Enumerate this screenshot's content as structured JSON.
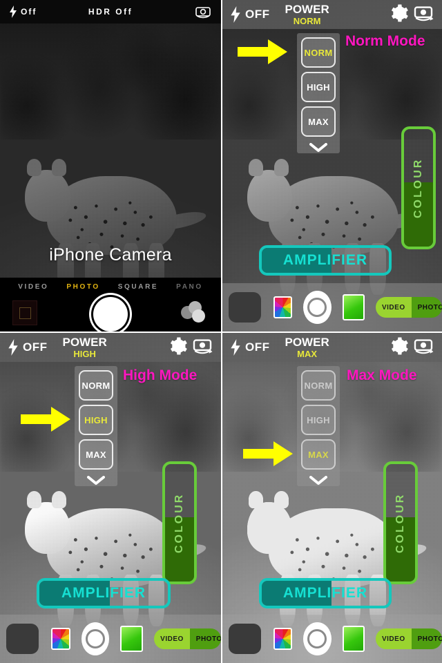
{
  "panels": {
    "ios": {
      "name": "iPhone Camera native app",
      "flash_label": "Off",
      "hdr_label": "HDR Off",
      "caption": "iPhone Camera",
      "flip_icon": "camera-flip-icon",
      "bolt_icon": "flash-bolt-icon",
      "modes": [
        {
          "label": "VIDEO",
          "state": "inactive"
        },
        {
          "label": "PHOTO",
          "state": "active"
        },
        {
          "label": "SQUARE",
          "state": "inactive"
        },
        {
          "label": "PANO",
          "state": "dim"
        }
      ]
    },
    "norm": {
      "name": "Norm Mode screenshot",
      "header": {
        "flash_label": "OFF",
        "power_label": "POWER",
        "power_value": "NORM",
        "bolt_icon": "flash-bolt-icon",
        "gear_icon": "gear-icon",
        "flip_icon": "camera-flip-icon"
      },
      "caption": "Norm Mode",
      "selected_mode": "NORM",
      "mode_buttons": [
        "NORM",
        "HIGH",
        "MAX"
      ],
      "chevron_icon": "chevron-down-icon",
      "arrow_icon": "right-arrow-icon",
      "colour_slider": {
        "label": "COLOUR",
        "fill_percent": 55
      },
      "amplifier_slider": {
        "label": "AMPLIFIER",
        "fill_percent": 55
      }
    },
    "high": {
      "name": "High Mode screenshot",
      "header": {
        "flash_label": "OFF",
        "power_label": "POWER",
        "power_value": "HIGH",
        "bolt_icon": "flash-bolt-icon",
        "gear_icon": "gear-icon",
        "flip_icon": "camera-flip-icon"
      },
      "caption": "High Mode",
      "selected_mode": "HIGH",
      "mode_buttons": [
        "NORM",
        "HIGH",
        "MAX"
      ],
      "chevron_icon": "chevron-down-icon",
      "arrow_icon": "right-arrow-icon",
      "colour_slider": {
        "label": "COLOUR",
        "fill_percent": 55
      },
      "amplifier_slider": {
        "label": "AMPLIFIER",
        "fill_percent": 55
      }
    },
    "max": {
      "name": "Max Mode screenshot",
      "header": {
        "flash_label": "OFF",
        "power_label": "POWER",
        "power_value": "MAX",
        "bolt_icon": "flash-bolt-icon",
        "gear_icon": "gear-icon",
        "flip_icon": "camera-flip-icon"
      },
      "caption": "Max Mode",
      "selected_mode": "MAX",
      "mode_buttons": [
        "NORM",
        "HIGH",
        "MAX"
      ],
      "chevron_icon": "chevron-down-icon",
      "arrow_icon": "right-arrow-icon",
      "colour_slider": {
        "label": "COLOUR",
        "fill_percent": 55
      },
      "amplifier_slider": {
        "label": "AMPLIFIER",
        "fill_percent": 55
      }
    }
  },
  "app_bar": {
    "thumbnail": "last-photo-thumbnail",
    "colour_wheel_icon": "colour-wheel-icon",
    "shutter_icon": "shutter-button",
    "green_filter_icon": "green-filter-icon",
    "toggle": {
      "video_label": "VIDEO",
      "photos_label": "PHOTOS",
      "selected": "PHOTOS"
    }
  },
  "colors": {
    "accent_yellow": "#e8e83a",
    "caption_magenta": "#ff16c0",
    "slider_green": "#68cc3a",
    "slider_green_fill": "#2f6b06",
    "amplifier_teal": "#14c8bd",
    "amplifier_fill": "#0b7b73",
    "arrow_yellow": "#ffff00"
  }
}
